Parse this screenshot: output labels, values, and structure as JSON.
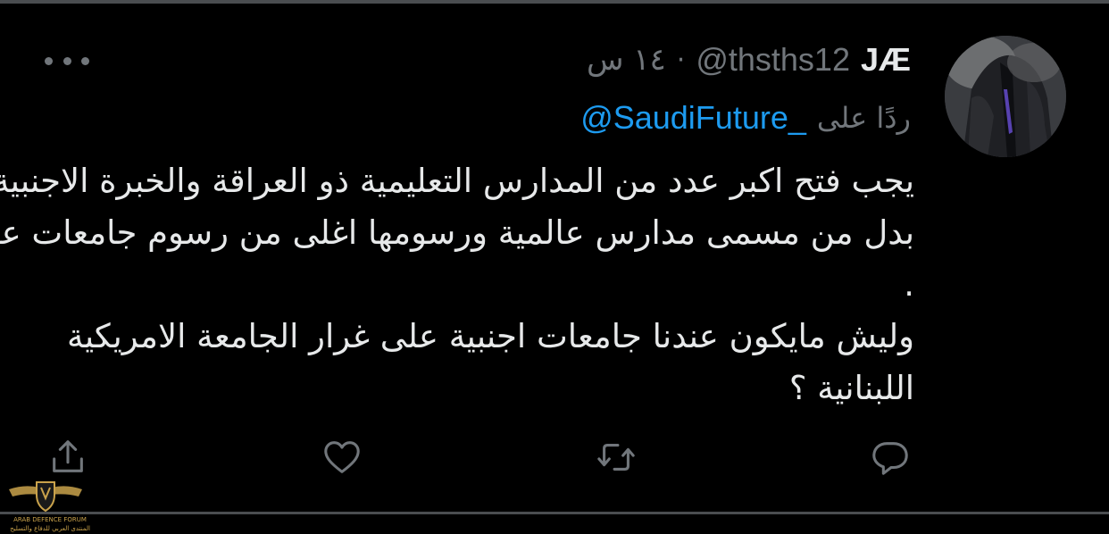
{
  "tweet": {
    "display_name": "JÆ",
    "handle": "@thsths12",
    "separator": "·",
    "time": "١٤ س",
    "replying_label": "ردًا على",
    "replying_handle": "@SaudiFuture_",
    "lines": [
      "يجب فتح اكبر عدد من المدارس التعليمية ذو العراقة والخبرة الاجنبية",
      "بدل من مسمى مدارس عالمية ورسومها اغلى من رسوم جامعات عربية",
      ".",
      "وليش مايكون عندنا جامعات اجنبية على غرار الجامعة الامريكية",
      "اللبنانية ؟"
    ]
  },
  "actions": {
    "share": "share-icon",
    "like": "heart-icon",
    "retweet": "retweet-icon",
    "reply": "reply-icon"
  },
  "watermark": {
    "line1": "ARAB DEFENCE FORUM",
    "line2": "المنتدى العربي للدفاع والتسليح"
  },
  "colors": {
    "background": "#000000",
    "text": "#e7e9ea",
    "muted": "#71767b",
    "link": "#1d9bf0",
    "divider": "#4a4d50",
    "watermark": "#c9a24b"
  }
}
